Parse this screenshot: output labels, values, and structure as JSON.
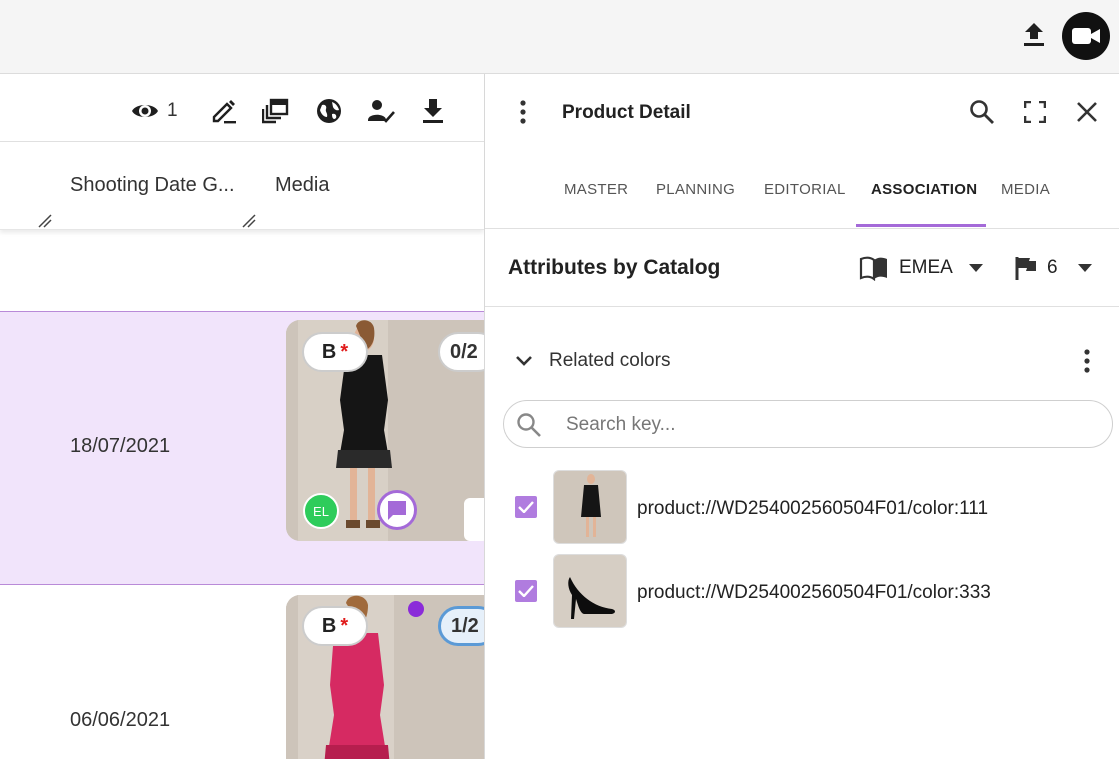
{
  "topbar": {
    "upload_icon": "upload-icon",
    "video_icon": "video-camera-icon"
  },
  "toolbar": {
    "view_count": "1"
  },
  "columns": {
    "shooting_date": "Shooting Date G...",
    "media": "Media"
  },
  "rows": [
    {
      "date": "18/07/2021",
      "badge": "B",
      "required_mark": "*",
      "count": "0/2",
      "avatar": "EL"
    },
    {
      "date": "06/06/2021",
      "badge": "B",
      "required_mark": "*",
      "count": "1/2"
    }
  ],
  "panel": {
    "title": "Product Detail",
    "tabs": [
      "MASTER",
      "PLANNING",
      "EDITORIAL",
      "ASSOCIATION",
      "MEDIA"
    ],
    "active_tab": "ASSOCIATION",
    "section_title": "Attributes by Catalog",
    "catalog": "EMEA",
    "flag_count": "6",
    "group_label": "Related colors",
    "search": {
      "placeholder": "Search key...",
      "value": ""
    },
    "items": [
      {
        "key": "product://WD254002560504F01/color:111",
        "checked": true,
        "thumb": "black-dress-thumbnail"
      },
      {
        "key": "product://WD254002560504F01/color:333",
        "checked": true,
        "thumb": "black-heel-shoe-thumbnail"
      }
    ]
  },
  "colors": {
    "accent": "#a46ad8",
    "selected_row": "#f1e4fb",
    "checkbox": "#b07cdf",
    "avatar": "#2ecc5b"
  }
}
